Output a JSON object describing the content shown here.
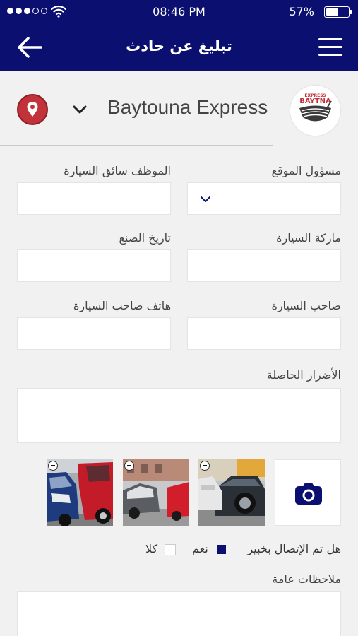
{
  "status_bar": {
    "time": "08:46 PM",
    "battery": "57%",
    "battery_level": 0.57
  },
  "nav": {
    "title": "تبليغ عن حادث"
  },
  "company": {
    "name": "Baytouna Express",
    "logo_small": "EXPRESS",
    "logo_big": "BAYTNA"
  },
  "form": {
    "site_manager_label": "مسؤول الموقع",
    "driver_label": "الموظف سائق السيارة",
    "car_brand_label": "ماركة السيارة",
    "manufacture_date_label": "تاريخ الصنع",
    "car_owner_label": "صاحب السيارة",
    "owner_phone_label": "هاتف صاحب السيارة",
    "damages_label": "الأضرار الحاصلة",
    "expert_question": "هل تم الإتصال بخبير",
    "yes_label": "نعم",
    "no_label": "كلا",
    "yes_checked": true,
    "no_checked": false,
    "notes_label": "ملاحظات عامة"
  },
  "colors": {
    "primary": "#0b1070",
    "pin": "#c2323a",
    "background": "#f1f1f1"
  },
  "icons": [
    "back-arrow-icon",
    "menu-icon",
    "location-pin-icon",
    "chevron-down-icon",
    "camera-icon",
    "remove-icon"
  ]
}
